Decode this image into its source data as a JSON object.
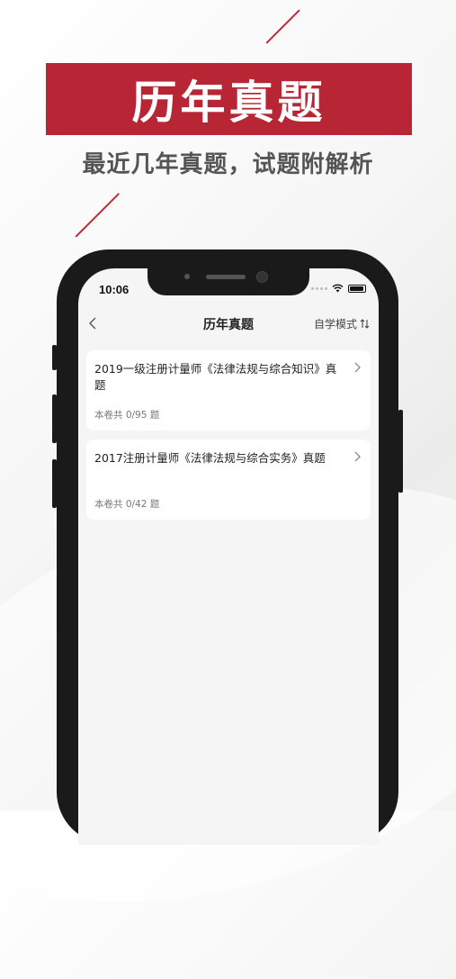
{
  "banner": {
    "title": "历年真题"
  },
  "subtitle": "最近几年真题，试题附解析",
  "status_bar": {
    "time": "10:06"
  },
  "nav": {
    "title": "历年真题",
    "mode_label": "自学模式"
  },
  "papers": [
    {
      "title": "2019一级注册计量师《法律法规与综合知识》真题",
      "count": "本卷共 0/95 题"
    },
    {
      "title": "2017注册计量师《法律法规与综合实务》真题",
      "count": "本卷共 0/42 题"
    }
  ],
  "colors": {
    "accent": "#b82636",
    "background": "#f5f5f5"
  }
}
